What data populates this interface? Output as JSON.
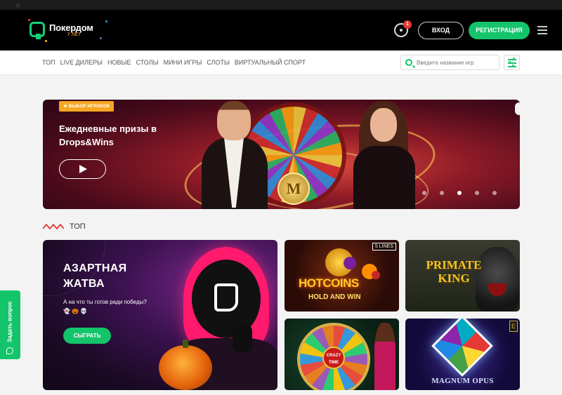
{
  "header": {
    "logo_name": "Покердом",
    "logo_sub": "7 ЛЕТ",
    "notification_count": "1",
    "login_label": "ВХОД",
    "register_label": "РЕГИСТРАЦИЯ"
  },
  "nav": {
    "items": [
      "ТОП",
      "LIVE ДИЛЕРЫ",
      "НОВЫЕ",
      "СТОЛЫ",
      "МИНИ ИГРЫ",
      "СЛОТЫ",
      "ВИРТУАЛЬНЫЙ СПОРТ"
    ],
    "search_placeholder": "Введите название игр"
  },
  "banner": {
    "badge": "★ ВЫБОР ИГРОКОВ",
    "title_line1": "Ежедневные призы в",
    "title_line2": "Drops&Wins",
    "wheel_letter": "M",
    "slide_count": 5,
    "active_slide": 3
  },
  "section": {
    "title": "ТОП"
  },
  "promo": {
    "title_line1": "АЗАРТНАЯ",
    "title_line2": "ЖАТВА",
    "text": "А на что ты готов ради победы? 👻 🎃 💀",
    "button": "СЫГРАТЬ"
  },
  "games": [
    {
      "title": "HOTCOINS",
      "subtitle": "HOLD AND WIN",
      "badge": "5 LINES"
    },
    {
      "title_line1": "PRIMATE",
      "title_line2": "KING"
    },
    {
      "title_line1": "CRAZY",
      "title_line2": "TIME"
    },
    {
      "title": "MAGNUM OPUS",
      "badge": "E"
    }
  ],
  "sidetab": {
    "label": "Задать вопрос"
  },
  "colors": {
    "accent": "#13c46b",
    "header_bg": "#000000",
    "badge": "#f5a623"
  }
}
